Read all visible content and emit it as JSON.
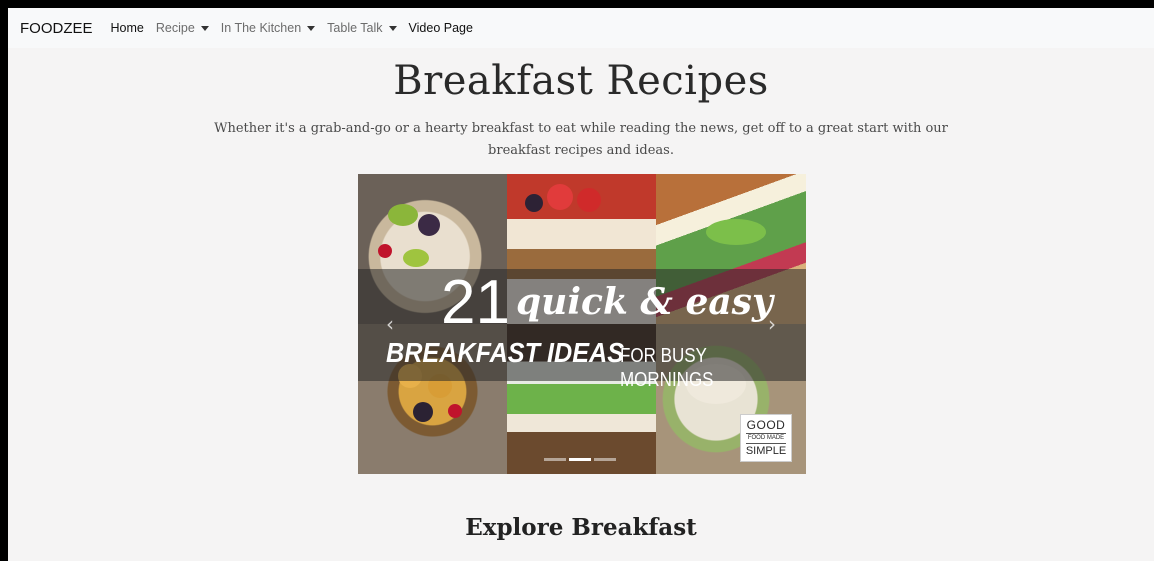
{
  "navbar": {
    "brand": "FOODZEE",
    "items": [
      {
        "label": "Home",
        "dropdown": false,
        "active": true
      },
      {
        "label": "Recipe",
        "dropdown": true,
        "active": false
      },
      {
        "label": "In The Kitchen",
        "dropdown": true,
        "active": false
      },
      {
        "label": "Table Talk",
        "dropdown": true,
        "active": false
      },
      {
        "label": "Video Page",
        "dropdown": false,
        "active": true
      }
    ]
  },
  "hero": {
    "title": "Breakfast Recipes",
    "subtitle": "Whether it's a grab-and-go or a hearty breakfast to eat while reading the news, get off to a great start with our breakfast recipes and ideas."
  },
  "carousel": {
    "image_text": {
      "number": "21",
      "script": "quick & easy",
      "bold": "BREAKFAST IDEAS",
      "small": "FOR BUSY MORNINGS"
    },
    "logo": {
      "line1": "GOOD",
      "line2": "FOOD MADE",
      "line3": "SIMPLE"
    },
    "prev_icon": "chevron-left-icon",
    "next_icon": "chevron-right-icon",
    "active_indicator": 1,
    "indicator_count": 3
  },
  "section": {
    "heading": "Explore Breakfast"
  },
  "colors": {
    "page_background": "#f5f4f4",
    "navbar_background": "#f8f9fa",
    "frame_border": "#000000"
  }
}
